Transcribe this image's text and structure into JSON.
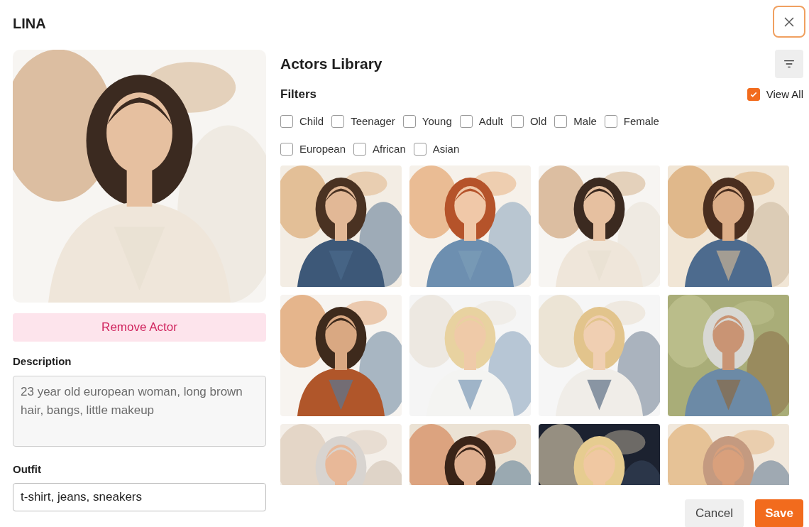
{
  "title": "LINA",
  "remove_button": "Remove Actor",
  "description": {
    "label": "Description",
    "value": "23 year old european woman, long brown hair, bangs, little makeup"
  },
  "outfit": {
    "label": "Outfit",
    "value": "t-shirt, jeans, sneakers"
  },
  "library": {
    "title": "Actors Library",
    "filters_label": "Filters",
    "view_all": {
      "label": "View All",
      "checked": true
    },
    "filter_rows": [
      [
        {
          "label": "Child",
          "checked": false
        },
        {
          "label": "Teenager",
          "checked": false
        },
        {
          "label": "Young",
          "checked": false
        },
        {
          "label": "Adult",
          "checked": false
        },
        {
          "label": "Old",
          "checked": false
        },
        {
          "label": "Male",
          "checked": false
        },
        {
          "label": "Female",
          "checked": false
        }
      ],
      [
        {
          "label": "European",
          "checked": false
        },
        {
          "label": "African",
          "checked": false
        },
        {
          "label": "Asian",
          "checked": false
        }
      ]
    ]
  },
  "buttons": {
    "cancel": "Cancel",
    "save": "Save"
  }
}
